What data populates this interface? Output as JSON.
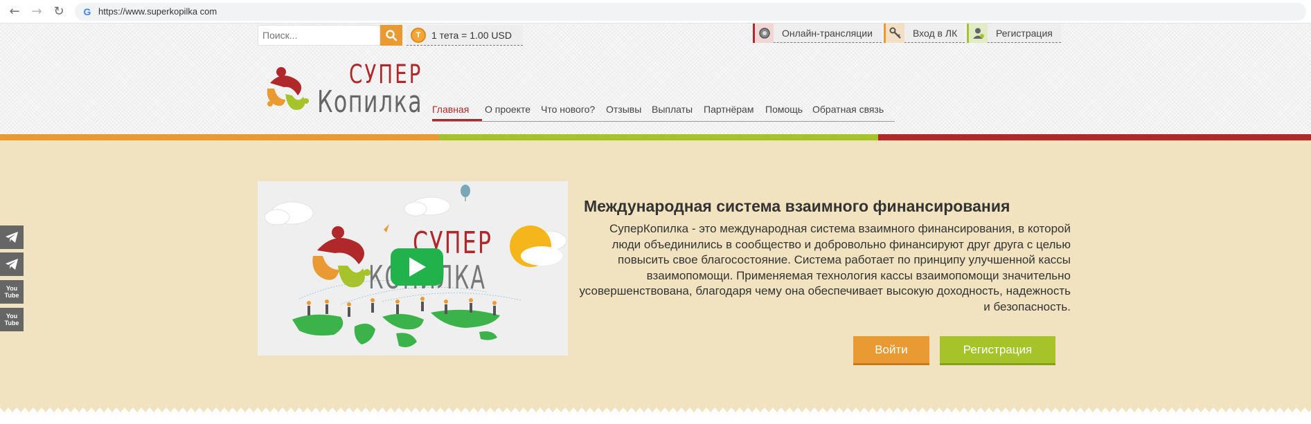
{
  "browser": {
    "url": "https://www.superkopilka com"
  },
  "header": {
    "search_placeholder": "Поиск...",
    "rate_text": "1 тета = 1.00 USD",
    "coin_letter": "T",
    "top_links": [
      {
        "label": "Онлайн-трансляции"
      },
      {
        "label": "Вход в ЛК"
      },
      {
        "label": "Регистрация"
      }
    ],
    "logo_line1": "СУПЕР",
    "logo_line2": "Копилка"
  },
  "menu": {
    "items": [
      {
        "label": "Главная",
        "active": true
      },
      {
        "label": "О проекте"
      },
      {
        "label": "Что нового?"
      },
      {
        "label": "Отзывы"
      },
      {
        "label": "Выплаты"
      },
      {
        "label": "Партнёрам"
      },
      {
        "label": "Помощь"
      },
      {
        "label": "Обратная связь"
      }
    ]
  },
  "hero": {
    "title": "Международная система взаимного финансирования",
    "description": "СуперКопилка - это международная система взаимного финансирования, в которой люди объединились в сообщество и добровольно финансируют друг друга с целью повысить свое благосостояние. Система работает по принципу улучшенной кассы взаимопомощи. Применяемая технология кассы взаимопомощи значительно усовершенствована, благодаря чему она обеспечивает высокую доходность, надежность и безопасность.",
    "login_label": "Войти",
    "register_label": "Регистрация",
    "video_logo_line1": "СУПЕР",
    "video_logo_line2": "КОПИЛКА"
  },
  "social": {
    "youtube_label_1": "You",
    "youtube_label_2": "Tube"
  },
  "colors": {
    "orange": "#e99a32",
    "green": "#a6c32a",
    "red": "#b0282a",
    "beige": "#f1e3bf"
  }
}
